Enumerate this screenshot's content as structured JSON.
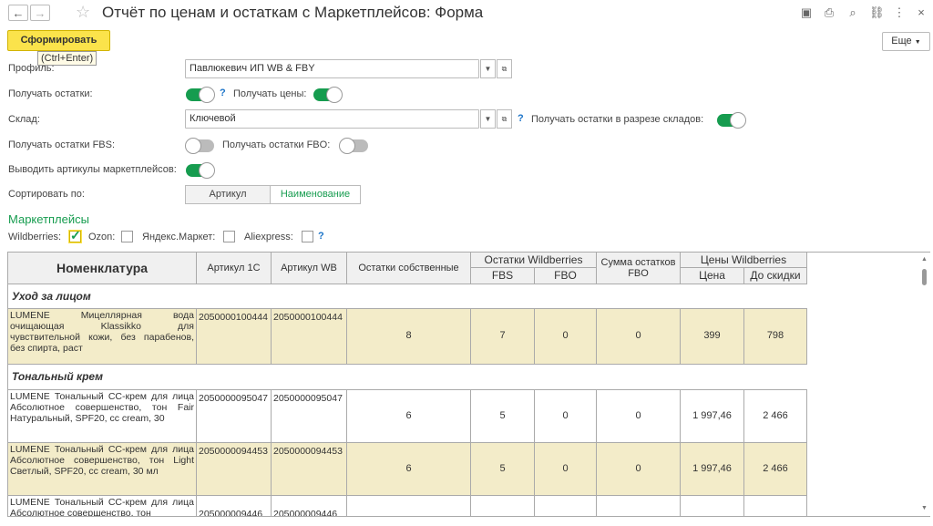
{
  "window": {
    "title": "Отчёт по ценам и остаткам с Маркетплейсов: Форма",
    "icons": [
      "back-icon",
      "forward-icon",
      "star-icon",
      "save-icon",
      "print-icon",
      "preview-icon",
      "link-icon",
      "more-icon",
      "close-icon"
    ]
  },
  "toolbar": {
    "generate_label": "Сформировать",
    "generate_tooltip": "(Ctrl+Enter)",
    "more_label": "Еще"
  },
  "form": {
    "profile_label": "Профиль:",
    "profile_value": "Павлюкевич ИП WB & FBY",
    "get_stocks_label": "Получать остатки:",
    "get_prices_label": "Получать цены:",
    "warehouse_label": "Склад:",
    "warehouse_value": "Ключевой",
    "stocks_by_warehouse_label": "Получать остатки в разрезе складов:",
    "fbs_label": "Получать остатки FBS:",
    "fbo_label": "Получать остатки FBO:",
    "articles_label": "Выводить артикулы маркетплейсов:",
    "sort_label": "Сортировать по:",
    "sort_options": [
      "Артикул",
      "Наименование"
    ],
    "help_mark": "?"
  },
  "marketplaces": {
    "title": "Маркетплейсы",
    "items": [
      {
        "label": "Wildberries:",
        "checked": true
      },
      {
        "label": "Ozon:",
        "checked": false
      },
      {
        "label": "Яндекс.Маркет:",
        "checked": false
      },
      {
        "label": "Aliexpress:",
        "checked": false
      }
    ]
  },
  "table": {
    "headers": {
      "nomenclature": "Номенклатура",
      "article_1c": "Артикул 1С",
      "article_wb": "Артикул WB",
      "own_stock": "Остатки собственные",
      "wb_stocks": "Остатки Wildberries",
      "fbs": "FBS",
      "fbo": "FBO",
      "fbo_sum": "Сумма остатков FBO",
      "wb_prices": "Цены Wildberries",
      "price": "Цена",
      "before_discount": "До скидки"
    },
    "groups": [
      {
        "name": "Уход за лицом",
        "rows": [
          {
            "name": "LUMENE Мицеллярная вода очищающая Klassikko для чувствительной кожи, без парабенов, без спирта, раст",
            "art1c": "2050000100444",
            "artwb": "2050000100444",
            "own": "8",
            "fbs": "7",
            "fbo": "0",
            "sum": "0",
            "price": "399",
            "before": "798"
          }
        ]
      },
      {
        "name": "Тональный крем",
        "rows": [
          {
            "name": "LUMENE Тональный СС-крем для лица Абсолютное совершенство, тон Fair Натуральный, SPF20, cc cream, 30",
            "art1c": "2050000095047",
            "artwb": "2050000095047",
            "own": "6",
            "fbs": "5",
            "fbo": "0",
            "sum": "0",
            "price": "1 997,46",
            "before": "2 466"
          },
          {
            "name": "LUMENE Тональный СС-крем для лица Абсолютное совершенство, тон Light Светлый, SPF20, cc cream, 30 мл",
            "art1c": "2050000094453",
            "artwb": "2050000094453",
            "own": "6",
            "fbs": "5",
            "fbo": "0",
            "sum": "0",
            "price": "1 997,46",
            "before": "2 466"
          },
          {
            "name": "LUMENE Тональный СС-крем для лица Абсолютное совершенство, тон",
            "art1c": "205000009446",
            "artwb": "205000009446",
            "own": "",
            "fbs": "",
            "fbo": "",
            "sum": "",
            "price": "",
            "before": ""
          }
        ]
      }
    ]
  }
}
